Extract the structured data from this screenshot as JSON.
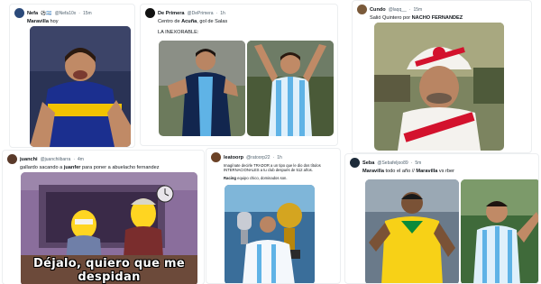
{
  "tweets": [
    {
      "name": "Nefa",
      "badges": "⚽🇦🇷",
      "handle": "@Nefa10x",
      "time": "15m",
      "lines": [
        {
          "bold": "Maravilla",
          "rest": " hoy"
        }
      ],
      "avatar_color": "#2b4a7a"
    },
    {
      "name": "De Primera",
      "badges": "",
      "handle": "@DePrimera",
      "time": "1h",
      "lines": [
        {
          "bold": "",
          "rest": "Centro de "
        },
        {
          "bold": "",
          "rest": "LA INEXORABLE:"
        }
      ],
      "line1_bold": "Acuña",
      "line1_tail": ", gol de Salas",
      "avatar_color": "#111111"
    },
    {
      "name": "Cundo",
      "badges": "",
      "handle": "@laqq__",
      "time": "15m",
      "lines": [
        {
          "bold": "",
          "rest": "Salió Quintero por "
        }
      ],
      "line1_bold": "NACHO FERNÁNDEZ",
      "avatar_color": "#7a5a3a"
    },
    {
      "name": "juanchi",
      "badges": "",
      "handle": "@juanchiibarra",
      "time": "4m",
      "lines": [
        {
          "bold": "",
          "rest": "gallardo sacando a "
        }
      ],
      "line1_bold": "juanfer",
      "line1_tail": " para poner a abuelacho fernandez",
      "avatar_color": "#5a3a2a"
    },
    {
      "name": "leatoorp",
      "badges": "",
      "handle": "@ratoorp22",
      "time": "1h",
      "lines": [
        {
          "bold": "",
          "rest": "Imagínate decirle TRADOR a un tipo que le dio dos títulos"
        },
        {
          "bold": "",
          "rest": "INTERNACIONALES a tu club después de 512 años."
        },
        {
          "bold": "Racing",
          "rest": " equipo chico, dominados son."
        }
      ],
      "avatar_color": "#6b4226"
    },
    {
      "name": "Seba",
      "badges": "",
      "handle": "@Sebafeljoo89",
      "time": "5m",
      "lines": [
        {
          "bold": "Maravilla",
          "rest": " todo el año // "
        }
      ],
      "line1_bold": "Maravilla",
      "line1_tail": " vs rber",
      "avatar_color": "#1d2b3a"
    }
  ],
  "meme_caption": "Déjalo, quiero que me despidan",
  "colors": {
    "boca_blue": "#1b2f8f",
    "boca_gold": "#f2c200",
    "racing_blue": "#5fb3e6",
    "river_red": "#d3122d",
    "brazil_yellow": "#f7d117"
  }
}
